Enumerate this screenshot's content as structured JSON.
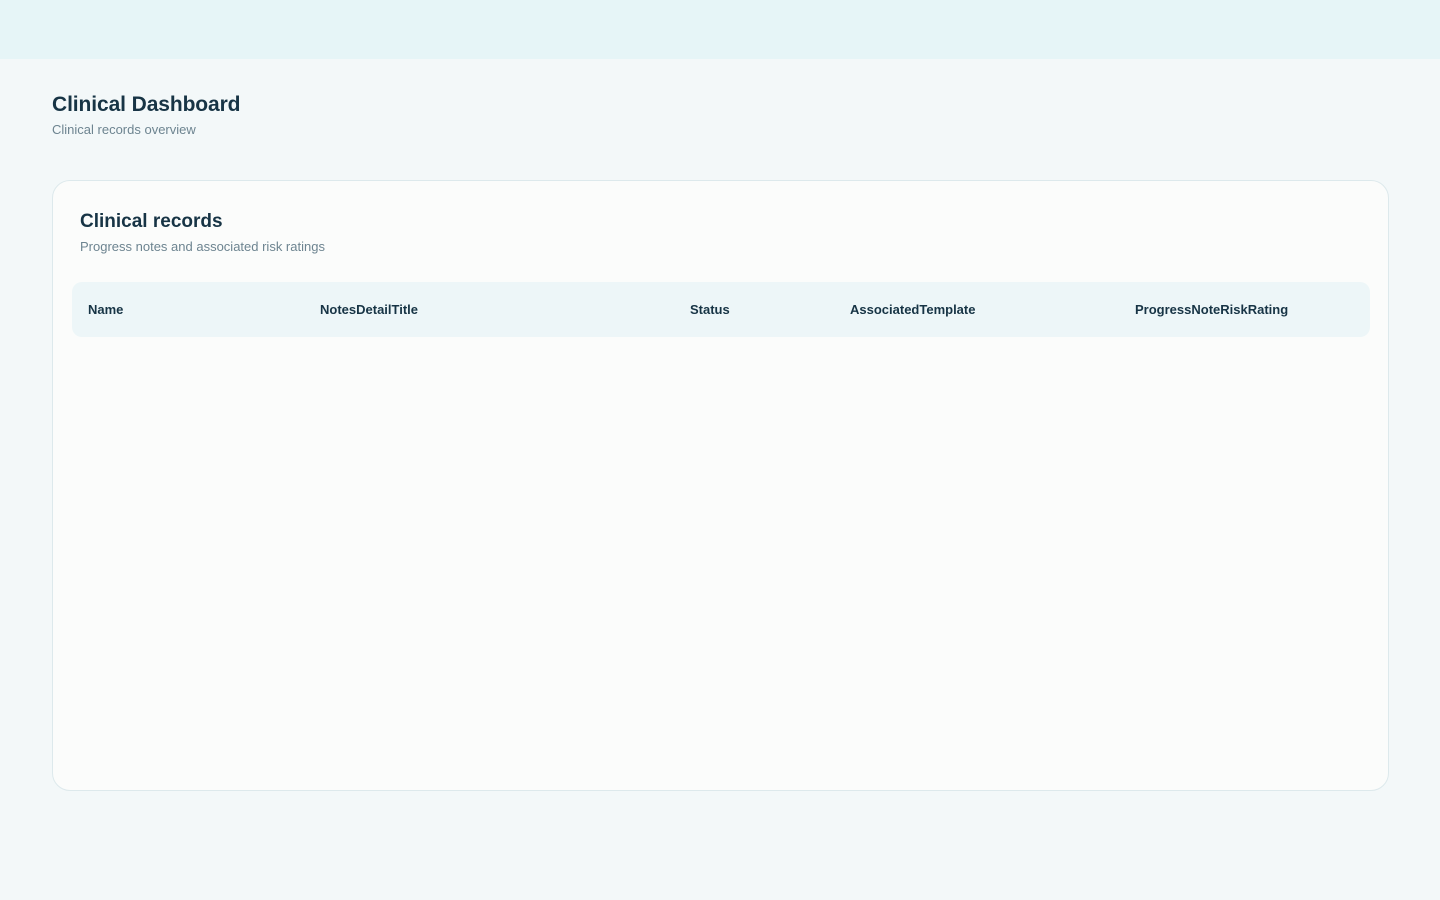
{
  "page": {
    "title": "Clinical Dashboard",
    "subtitle": "Clinical records overview"
  },
  "card": {
    "title": "Clinical records",
    "subtitle": "Progress notes and associated risk ratings"
  },
  "table": {
    "columns": [
      "Name",
      "NotesDetailTitle",
      "Status",
      "AssociatedTemplate",
      "ProgressNoteRiskRating"
    ],
    "rows": []
  },
  "colors": {
    "topbar": "#e6f5f7",
    "background": "#f3f8f9",
    "card": "#fbfcfb",
    "header_row": "#edf6f8",
    "text_primary": "#173445",
    "text_muted": "#6d8490"
  }
}
